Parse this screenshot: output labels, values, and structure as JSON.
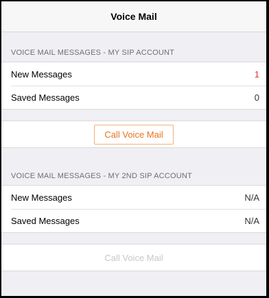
{
  "navbar": {
    "title": "Voice Mail"
  },
  "accounts": [
    {
      "header": "VOICE MAIL MESSAGES - MY SIP ACCOUNT",
      "new_label": "New Messages",
      "new_value": "1",
      "saved_label": "Saved Messages",
      "saved_value": "0",
      "button_label": "Call Voice Mail",
      "button_enabled": true
    },
    {
      "header": "VOICE MAIL MESSAGES - MY 2ND SIP ACCOUNT",
      "new_label": "New Messages",
      "new_value": "N/A",
      "saved_label": "Saved Messages",
      "saved_value": "N/A",
      "button_label": "Call Voice Mail",
      "button_enabled": false
    }
  ],
  "colors": {
    "accent": "#e8731a",
    "badge_red": "#e0342a",
    "disabled": "#c8c8c8"
  }
}
